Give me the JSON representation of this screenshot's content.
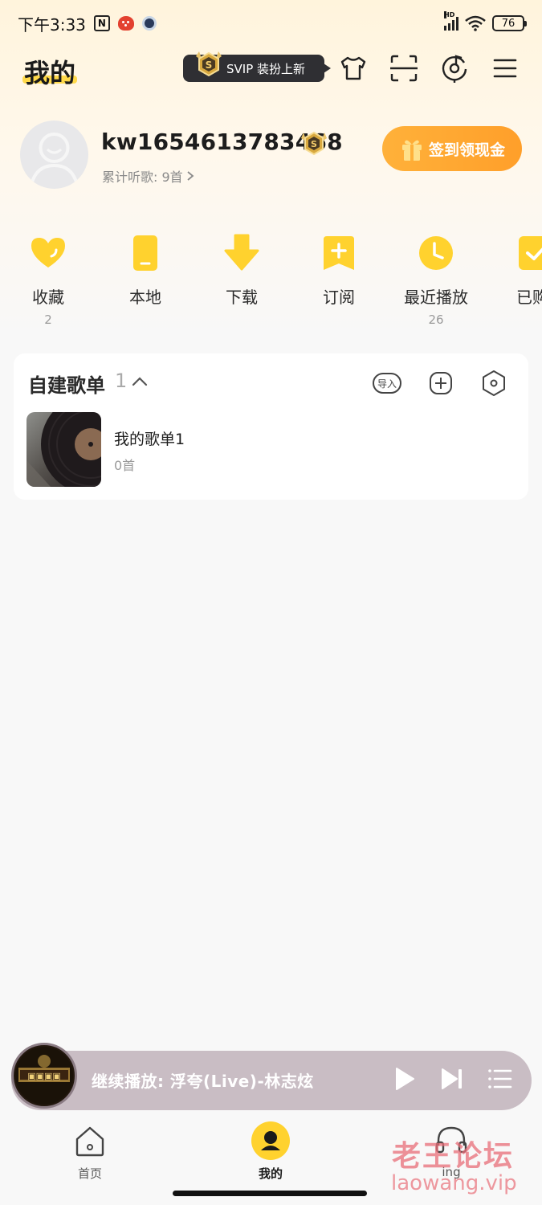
{
  "status_bar": {
    "time": "下午3:33",
    "network": "HD",
    "battery": "76"
  },
  "header": {
    "title": "我的",
    "svip_promo": "SVIP 装扮上新",
    "icons": [
      "tshirt-icon",
      "scan-icon",
      "music-radar-icon",
      "menu-icon"
    ]
  },
  "profile": {
    "username": "kw1654613783468",
    "listen_stat": "累计听歌: 9首",
    "checkin_label": "签到领现金"
  },
  "quick_actions": [
    {
      "label": "收藏",
      "count": "2",
      "icon": "heart-icon"
    },
    {
      "label": "本地",
      "count": "",
      "icon": "phone-icon"
    },
    {
      "label": "下载",
      "count": "",
      "icon": "download-icon"
    },
    {
      "label": "订阅",
      "count": "",
      "icon": "subscribe-icon"
    },
    {
      "label": "最近播放",
      "count": "26",
      "icon": "clock-icon"
    },
    {
      "label": "已购",
      "count": "",
      "icon": "purchased-icon"
    }
  ],
  "playlists_card": {
    "title": "自建歌单",
    "count": "1",
    "import_label": "导入",
    "items": [
      {
        "name": "我的歌单1",
        "count": "0首"
      }
    ]
  },
  "mini_player": {
    "text": "继续播放: 浮夸(Live)-林志炫"
  },
  "bottom_nav": {
    "items": [
      {
        "label": "首页"
      },
      {
        "label": "我的"
      },
      {
        "label": "ing"
      }
    ]
  },
  "watermark": {
    "line1": "老王论坛",
    "line2": "laowang.vip"
  },
  "colors": {
    "accent_yellow": "#ffd22e",
    "checkin_orange": "#ffa733",
    "player_bg": "#c9bdc4"
  }
}
